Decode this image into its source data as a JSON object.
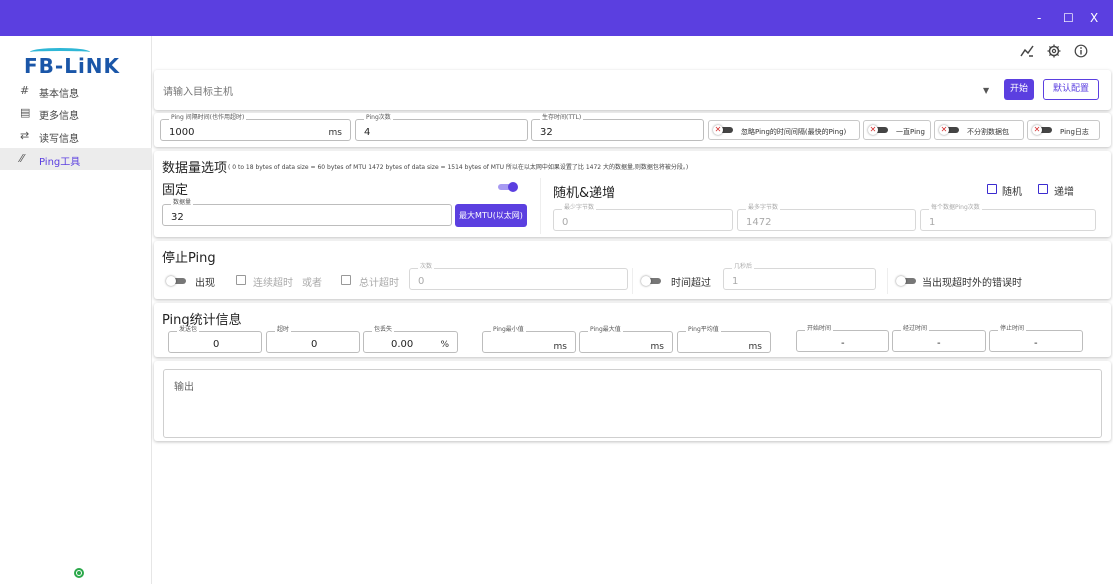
{
  "window": {
    "minimize": "-",
    "maximize": "☐",
    "close": "X",
    "accent": "#5b3fe0"
  },
  "logo": {
    "text": "FB-LiNK"
  },
  "sidebar": {
    "items": [
      {
        "icon": "#",
        "label": "基本信息"
      },
      {
        "icon": "▤",
        "label": "更多信息"
      },
      {
        "icon": "⇄",
        "label": "读写信息"
      },
      {
        "icon": "⁄⁄",
        "label": "Ping工具"
      }
    ],
    "active_index": 3
  },
  "toolbar_icons": [
    "chart-icon",
    "gear-icon",
    "info-icon"
  ],
  "target": {
    "placeholder": "请输入目标主机",
    "start_label": "开始",
    "default_label": "默认配置"
  },
  "params": {
    "interval": {
      "legend": "Ping 间隔时间(也作用超时)",
      "value": "1000",
      "unit": "ms"
    },
    "count": {
      "legend": "Ping次数",
      "value": "4"
    },
    "ttl": {
      "legend": "生存时间(TTL)",
      "value": "32"
    },
    "toggles": [
      {
        "label": "忽略Ping的时间间隔(最快的Ping)"
      },
      {
        "label": "一直Ping"
      },
      {
        "label": "不分割数据包"
      },
      {
        "label": "Ping日志"
      }
    ]
  },
  "datasize": {
    "title": "数据量选项",
    "note": "( 0 to 18 bytes of data size = 60 bytes of MTU 1472 bytes of data size = 1514 bytes of MTU 所以在以太网中如果设置了比 1472 大的数据量,则数据包将被分段。)",
    "fixed": {
      "title": "固定",
      "legend": "数据量",
      "value": "32",
      "max_btn": "最大MTU(以太网)"
    },
    "random": {
      "title": "随机&递增",
      "random_label": "随机",
      "incr_label": "递增",
      "min": {
        "legend": "最少字节数",
        "value": "0"
      },
      "max": {
        "legend": "最多字节数",
        "value": "1472"
      },
      "per": {
        "legend": "每个数据Ping次数",
        "value": "1"
      }
    }
  },
  "stop": {
    "title": "停止Ping",
    "appear": "出现",
    "consecutive": "连续超时",
    "or": "或者",
    "total": "总计超时",
    "count_legend": "次数",
    "count_value": "0",
    "time_exceed": "时间超过",
    "seconds_legend": "几秒后",
    "seconds_value": "1",
    "error_label": "当出现超时外的错误时"
  },
  "stats": {
    "title": "Ping统计信息",
    "sent": {
      "legend": "发送包",
      "value": "0"
    },
    "timeout": {
      "legend": "超时",
      "value": "0"
    },
    "loss": {
      "legend": "包丢失",
      "value": "0.00",
      "unit": "%"
    },
    "min": {
      "legend": "Ping最小值",
      "unit": "ms"
    },
    "max": {
      "legend": "Ping最大值",
      "unit": "ms"
    },
    "avg": {
      "legend": "Ping平均值",
      "unit": "ms"
    },
    "start": {
      "legend": "开始时间",
      "value": "-"
    },
    "elapsed": {
      "legend": "经过时间",
      "value": "-"
    },
    "stop": {
      "legend": "停止时间",
      "value": "-"
    }
  },
  "output": {
    "label": "输出"
  }
}
